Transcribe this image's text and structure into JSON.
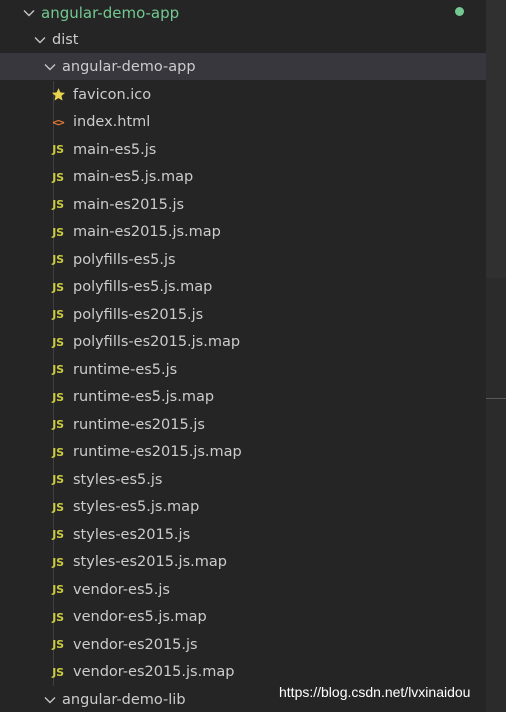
{
  "explorer": {
    "root": {
      "label": "angular-demo-app",
      "status_color": "#73c991"
    },
    "dist": {
      "label": "dist"
    },
    "app_folder": {
      "label": "angular-demo-app"
    },
    "files": [
      {
        "label": "favicon.ico",
        "icon": "star-icon"
      },
      {
        "label": "index.html",
        "icon": "html-icon"
      },
      {
        "label": "main-es5.js",
        "icon": "js-icon"
      },
      {
        "label": "main-es5.js.map",
        "icon": "js-icon"
      },
      {
        "label": "main-es2015.js",
        "icon": "js-icon"
      },
      {
        "label": "main-es2015.js.map",
        "icon": "js-icon"
      },
      {
        "label": "polyfills-es5.js",
        "icon": "js-icon"
      },
      {
        "label": "polyfills-es5.js.map",
        "icon": "js-icon"
      },
      {
        "label": "polyfills-es2015.js",
        "icon": "js-icon"
      },
      {
        "label": "polyfills-es2015.js.map",
        "icon": "js-icon"
      },
      {
        "label": "runtime-es5.js",
        "icon": "js-icon"
      },
      {
        "label": "runtime-es5.js.map",
        "icon": "js-icon"
      },
      {
        "label": "runtime-es2015.js",
        "icon": "js-icon"
      },
      {
        "label": "runtime-es2015.js.map",
        "icon": "js-icon"
      },
      {
        "label": "styles-es5.js",
        "icon": "js-icon"
      },
      {
        "label": "styles-es5.js.map",
        "icon": "js-icon"
      },
      {
        "label": "styles-es2015.js",
        "icon": "js-icon"
      },
      {
        "label": "styles-es2015.js.map",
        "icon": "js-icon"
      },
      {
        "label": "vendor-es5.js",
        "icon": "js-icon"
      },
      {
        "label": "vendor-es5.js.map",
        "icon": "js-icon"
      },
      {
        "label": "vendor-es2015.js",
        "icon": "js-icon"
      },
      {
        "label": "vendor-es2015.js.map",
        "icon": "js-icon"
      }
    ],
    "lib_folder": {
      "label": "angular-demo-lib"
    },
    "js_icon_text": "JS",
    "html_icon_text": "<>"
  },
  "watermark": "https://blog.csdn.net/lvxinaidou",
  "colors": {
    "background": "#252526",
    "selected_row": "#37373d",
    "js_icon": "#cbcb41",
    "html_icon": "#e37933",
    "star_icon": "#e8d44d",
    "git_modified": "#73c991"
  }
}
